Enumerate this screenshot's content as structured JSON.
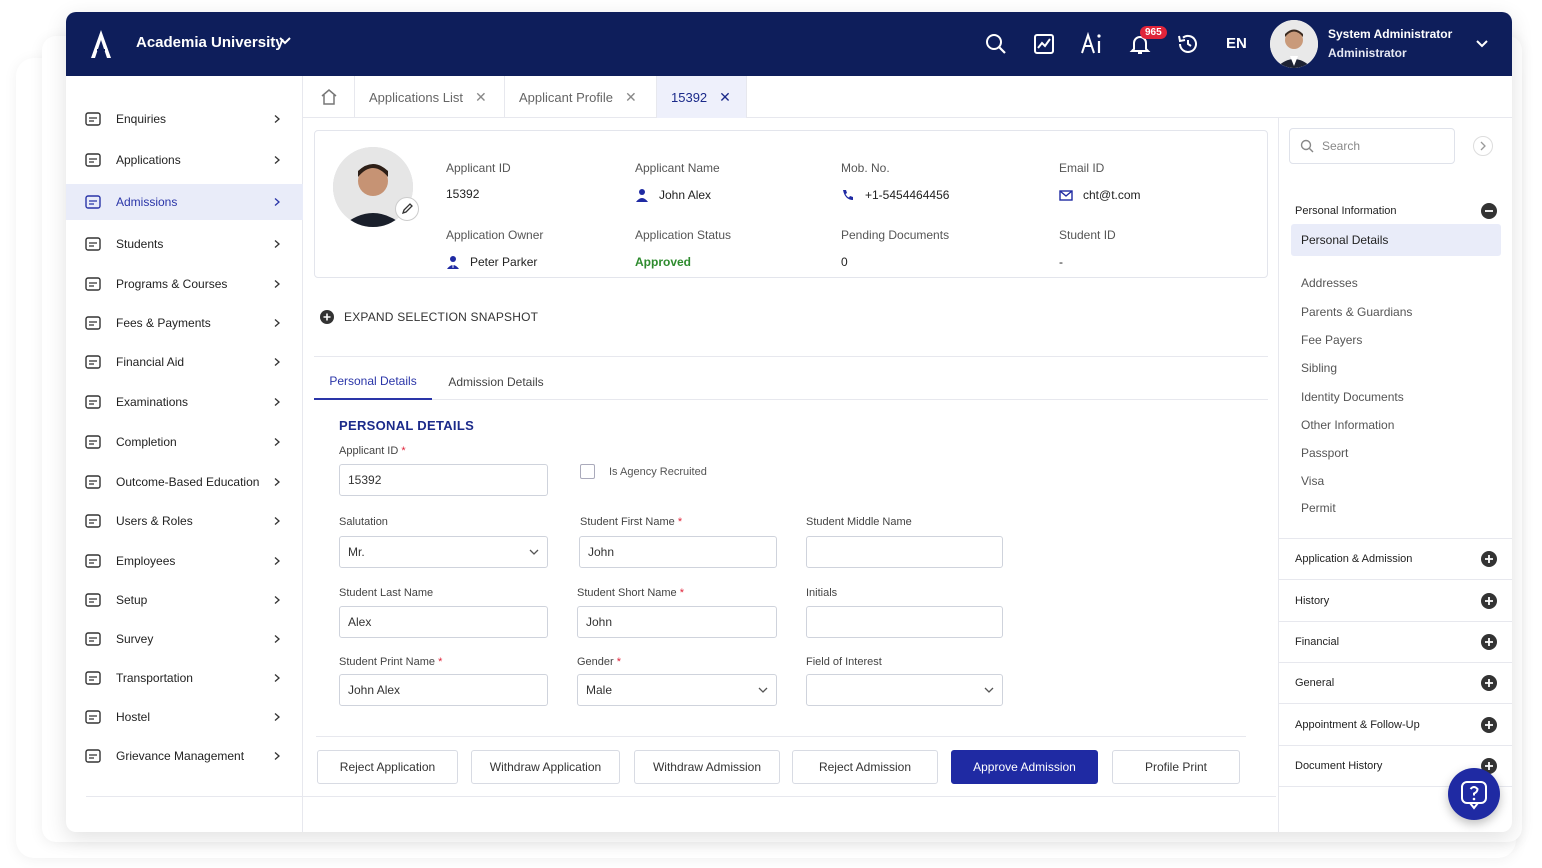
{
  "header": {
    "org_name": "Academia University",
    "notification_count": "965",
    "language": "EN",
    "user_name": "System Administrator",
    "user_role": "Administrator"
  },
  "sidebar": {
    "items": [
      {
        "label": "Enquiries",
        "icon": "enquiries-icon"
      },
      {
        "label": "Applications",
        "icon": "applications-icon"
      },
      {
        "label": "Admissions",
        "icon": "graduation-cap-icon",
        "active": true
      },
      {
        "label": "Students",
        "icon": "students-icon"
      },
      {
        "label": "Programs & Courses",
        "icon": "books-icon"
      },
      {
        "label": "Fees & Payments",
        "icon": "wallet-icon"
      },
      {
        "label": "Financial Aid",
        "icon": "hand-coins-icon"
      },
      {
        "label": "Examinations",
        "icon": "exam-icon"
      },
      {
        "label": "Completion",
        "icon": "flag-icon"
      },
      {
        "label": "Outcome-Based Education",
        "icon": "book-open-icon"
      },
      {
        "label": "Users & Roles",
        "icon": "users-icon"
      },
      {
        "label": "Employees",
        "icon": "employee-scan-icon"
      },
      {
        "label": "Setup",
        "icon": "gear-icon"
      },
      {
        "label": "Survey",
        "icon": "survey-icon"
      },
      {
        "label": "Transportation",
        "icon": "bus-icon"
      },
      {
        "label": "Hostel",
        "icon": "bed-icon"
      },
      {
        "label": "Grievance Management",
        "icon": "headset-icon"
      }
    ]
  },
  "tabs": {
    "items": [
      {
        "label": "Applications List"
      },
      {
        "label": "Applicant Profile"
      },
      {
        "label": "15392",
        "active": true
      }
    ]
  },
  "profile": {
    "applicant_id_label": "Applicant ID",
    "applicant_id": "15392",
    "applicant_name_label": "Applicant Name",
    "applicant_name": "John Alex",
    "mobile_label": "Mob. No.",
    "mobile": "+1-5454464456",
    "email_label": "Email ID",
    "email": "cht@t.com",
    "owner_label": "Application Owner",
    "owner": "Peter Parker",
    "status_label": "Application Status",
    "status": "Approved",
    "status_color": "#2e8b2e",
    "pending_label": "Pending Documents",
    "pending": "0",
    "student_id_label": "Student ID",
    "student_id": "-"
  },
  "expand_label": "EXPAND SELECTION SNAPSHOT",
  "subtabs": {
    "personal": "Personal Details",
    "admission": "Admission Details"
  },
  "form": {
    "section_title": "PERSONAL DETAILS",
    "applicant_id_label": "Applicant ID",
    "applicant_id_value": "15392",
    "agency_label": "Is Agency Recruited",
    "salutation_label": "Salutation",
    "salutation_value": "Mr.",
    "first_name_label": "Student First Name",
    "first_name_value": "John",
    "middle_name_label": "Student Middle Name",
    "middle_name_value": "",
    "last_name_label": "Student Last Name",
    "last_name_value": "Alex",
    "short_name_label": "Student Short Name",
    "short_name_value": "John",
    "initials_label": "Initials",
    "initials_value": "",
    "print_name_label": "Student Print Name",
    "print_name_value": "John Alex",
    "gender_label": "Gender",
    "gender_value": "Male",
    "interest_label": "Field of Interest",
    "interest_value": ""
  },
  "actions": {
    "reject_application": "Reject Application",
    "withdraw_application": "Withdraw Application",
    "withdraw_admission": "Withdraw Admission",
    "reject_admission": "Reject Admission",
    "approve_admission": "Approve Admission",
    "profile_print": "Profile Print"
  },
  "right_panel": {
    "search_placeholder": "Search",
    "personal_information": "Personal Information",
    "personal_items": [
      "Personal Details",
      "Addresses",
      "Parents & Guardians",
      "Fee Payers",
      "Sibling",
      "Identity Documents",
      "Other Information",
      "Passport",
      "Visa",
      "Permit"
    ],
    "sections": [
      "Application & Admission",
      "History",
      "Financial",
      "General",
      "Appointment & Follow-Up",
      "Document History"
    ]
  },
  "colors": {
    "brand_navy": "#0e1e5b",
    "primary": "#1f2aa3",
    "badge_red": "#e0243a"
  }
}
